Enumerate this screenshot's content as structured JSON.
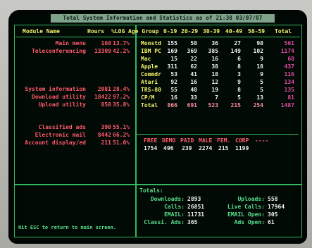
{
  "window": {
    "title": "Total System Information and Statistics as of 21:38 03/07/87"
  },
  "header": {
    "module_name": "Module Name",
    "hours": "Hours",
    "pct": "%LOG",
    "age_group": "Age Group",
    "age_cols": [
      "0-19",
      "20-29",
      "30-39",
      "40-49",
      "50-59",
      "Total"
    ]
  },
  "modules": [
    {
      "name": "Main menu",
      "hours": "168",
      "pct": "13.7%"
    },
    {
      "name": "Teleconferencing",
      "hours": "13309",
      "pct": "42.2%"
    },
    {
      "name": "",
      "hours": "",
      "pct": ""
    },
    {
      "name": "",
      "hours": "",
      "pct": ""
    },
    {
      "name": "",
      "hours": "",
      "pct": ""
    },
    {
      "name": "",
      "hours": "",
      "pct": ""
    },
    {
      "name": "System information",
      "hours": "2081",
      "pct": "28.4%"
    },
    {
      "name": "Download utility",
      "hours": "18422",
      "pct": "97.2%"
    },
    {
      "name": "Upload utility",
      "hours": "858",
      "pct": "35.8%"
    },
    {
      "name": "",
      "hours": "",
      "pct": ""
    },
    {
      "name": "Classified ads",
      "hours": "390",
      "pct": "55.1%"
    },
    {
      "name": "Electronic mail",
      "hours": "8442",
      "pct": "66.2%"
    },
    {
      "name": "Account display/ed",
      "hours": "211",
      "pct": "51.0%"
    }
  ],
  "computers": [
    {
      "name": "Monstd",
      "values": [
        "155",
        "58",
        "36",
        "27",
        "98",
        "561"
      ]
    },
    {
      "name": "IBM PC",
      "values": [
        "169",
        "369",
        "385",
        "149",
        "102",
        "1174"
      ]
    },
    {
      "name": "Mac",
      "values": [
        "15",
        "22",
        "16",
        "6",
        "9",
        "68"
      ]
    },
    {
      "name": "Apple",
      "values": [
        "311",
        "62",
        "38",
        "8",
        "18",
        "437"
      ]
    },
    {
      "name": "Commdr",
      "values": [
        "53",
        "41",
        "18",
        "3",
        "9",
        "116"
      ]
    },
    {
      "name": "Atari",
      "values": [
        "92",
        "16",
        "12",
        "9",
        "5",
        "134"
      ]
    },
    {
      "name": "TRS-80",
      "values": [
        "55",
        "48",
        "19",
        "8",
        "5",
        "135"
      ]
    },
    {
      "name": "CP/M",
      "values": [
        "16",
        "33",
        "7",
        "5",
        "13",
        "81"
      ]
    },
    {
      "name": "Total",
      "values": [
        "866",
        "691",
        "523",
        "215",
        "254",
        "1487"
      ]
    }
  ],
  "access": {
    "labels": [
      "FREE",
      "DEMO",
      "PAID",
      "MALE",
      "FEM.",
      "CORP",
      "----"
    ],
    "values": [
      "1754",
      "496",
      "239",
      "2274",
      "215",
      "1199",
      ""
    ]
  },
  "totals": {
    "title": "Totals:",
    "items": [
      {
        "label": "Downloads:",
        "value": "2893",
        "label2": "Uploads:",
        "value2": "558"
      },
      {
        "label": "Calls:",
        "value": "26851",
        "label2": "Live Calls:",
        "value2": "17964"
      },
      {
        "label": "EMAIL:",
        "value": "11731",
        "label2": "EMAIL Open:",
        "value2": "305"
      },
      {
        "label": "Classi. Ads:",
        "value": "365",
        "label2": "Ads Open:",
        "value2": "61"
      }
    ]
  },
  "footer": {
    "hint": "Hit ESC to return to main screen."
  },
  "colors": {
    "frame": "#31b860",
    "title_bar": "#7fa28a",
    "screen": "#020a06"
  }
}
